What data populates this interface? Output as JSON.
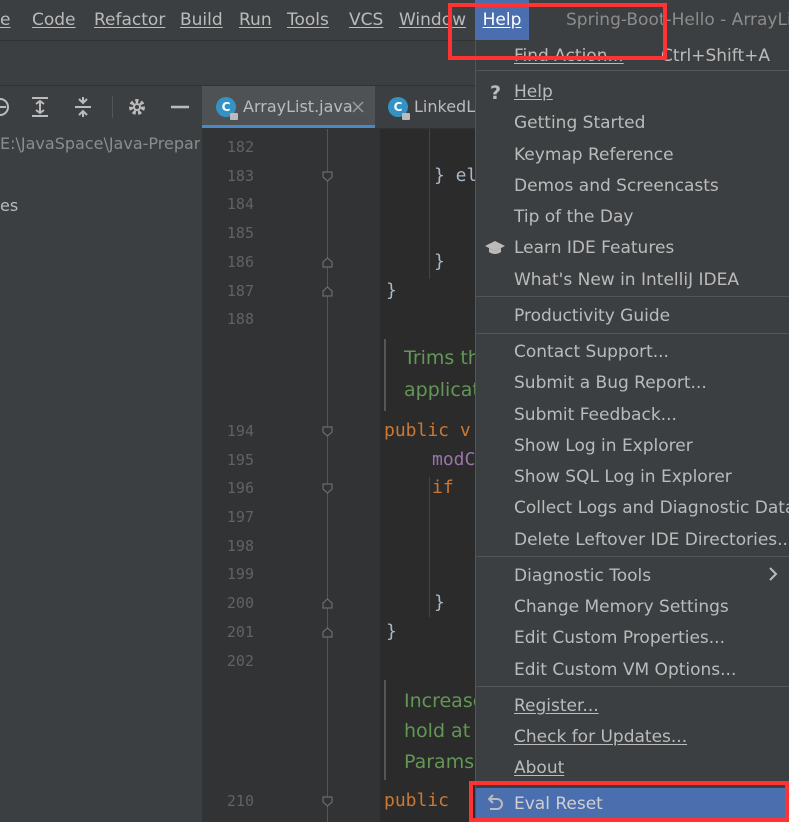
{
  "menubar": {
    "items": [
      {
        "label": "e"
      },
      {
        "label": "Code"
      },
      {
        "label": "Refactor"
      },
      {
        "label": "Build"
      },
      {
        "label": "Run"
      },
      {
        "label": "Tools"
      },
      {
        "label": "VCS"
      },
      {
        "label": "Window"
      },
      {
        "label": "Help"
      }
    ],
    "window_title": "Spring-Boot-Hello - ArrayList."
  },
  "project": {
    "path": "E:\\JavaSpace\\Java-Prepare",
    "node": "es"
  },
  "tabs": [
    {
      "label": "ArrayList.java",
      "icon": "c-class-icon",
      "active": true
    },
    {
      "label": "LinkedLi",
      "icon": "c-class-icon",
      "active": false
    }
  ],
  "gutter": {
    "lines": [
      "182",
      "183",
      "184",
      "185",
      "186",
      "187",
      "188",
      "194",
      "195",
      "196",
      "197",
      "198",
      "199",
      "200",
      "201",
      "202",
      "210"
    ]
  },
  "code": {
    "line_183": "} el",
    "line_186": "}",
    "line_187": "}",
    "doc1": [
      "Trims th",
      "applicati"
    ],
    "line_194_kw": "public v",
    "line_195": "modC",
    "line_196_kw": "if",
    "line_200": "}",
    "line_201": "}",
    "doc2": [
      "Increase",
      "hold at l",
      "Params:"
    ],
    "line_210_kw": "public"
  },
  "help_menu": {
    "find_action": {
      "label": "Find Action...",
      "shortcut": "Ctrl+Shift+A"
    },
    "group1": [
      "Help",
      "Getting Started",
      "Keymap Reference",
      "Demos and Screencasts",
      "Tip of the Day",
      "Learn IDE Features",
      "What's New in IntelliJ IDEA"
    ],
    "group2": [
      "Productivity Guide"
    ],
    "group3": [
      "Contact Support...",
      "Submit a Bug Report...",
      "Submit Feedback...",
      "Show Log in Explorer",
      "Show SQL Log in Explorer",
      "Collect Logs and Diagnostic Data",
      "Delete Leftover IDE Directories..."
    ],
    "group4": [
      "Diagnostic Tools",
      "Change Memory Settings",
      "Edit Custom Properties...",
      "Edit Custom VM Options..."
    ],
    "group5": [
      "Register...",
      "Check for Updates...",
      "About"
    ],
    "eval_reset": "Eval Reset"
  },
  "colors": {
    "menu_bg": "#3c3f41",
    "selection": "#4b6eaf",
    "annotation_red": "#ff3333",
    "doc_comment": "#629755",
    "keyword": "#cc7832"
  }
}
